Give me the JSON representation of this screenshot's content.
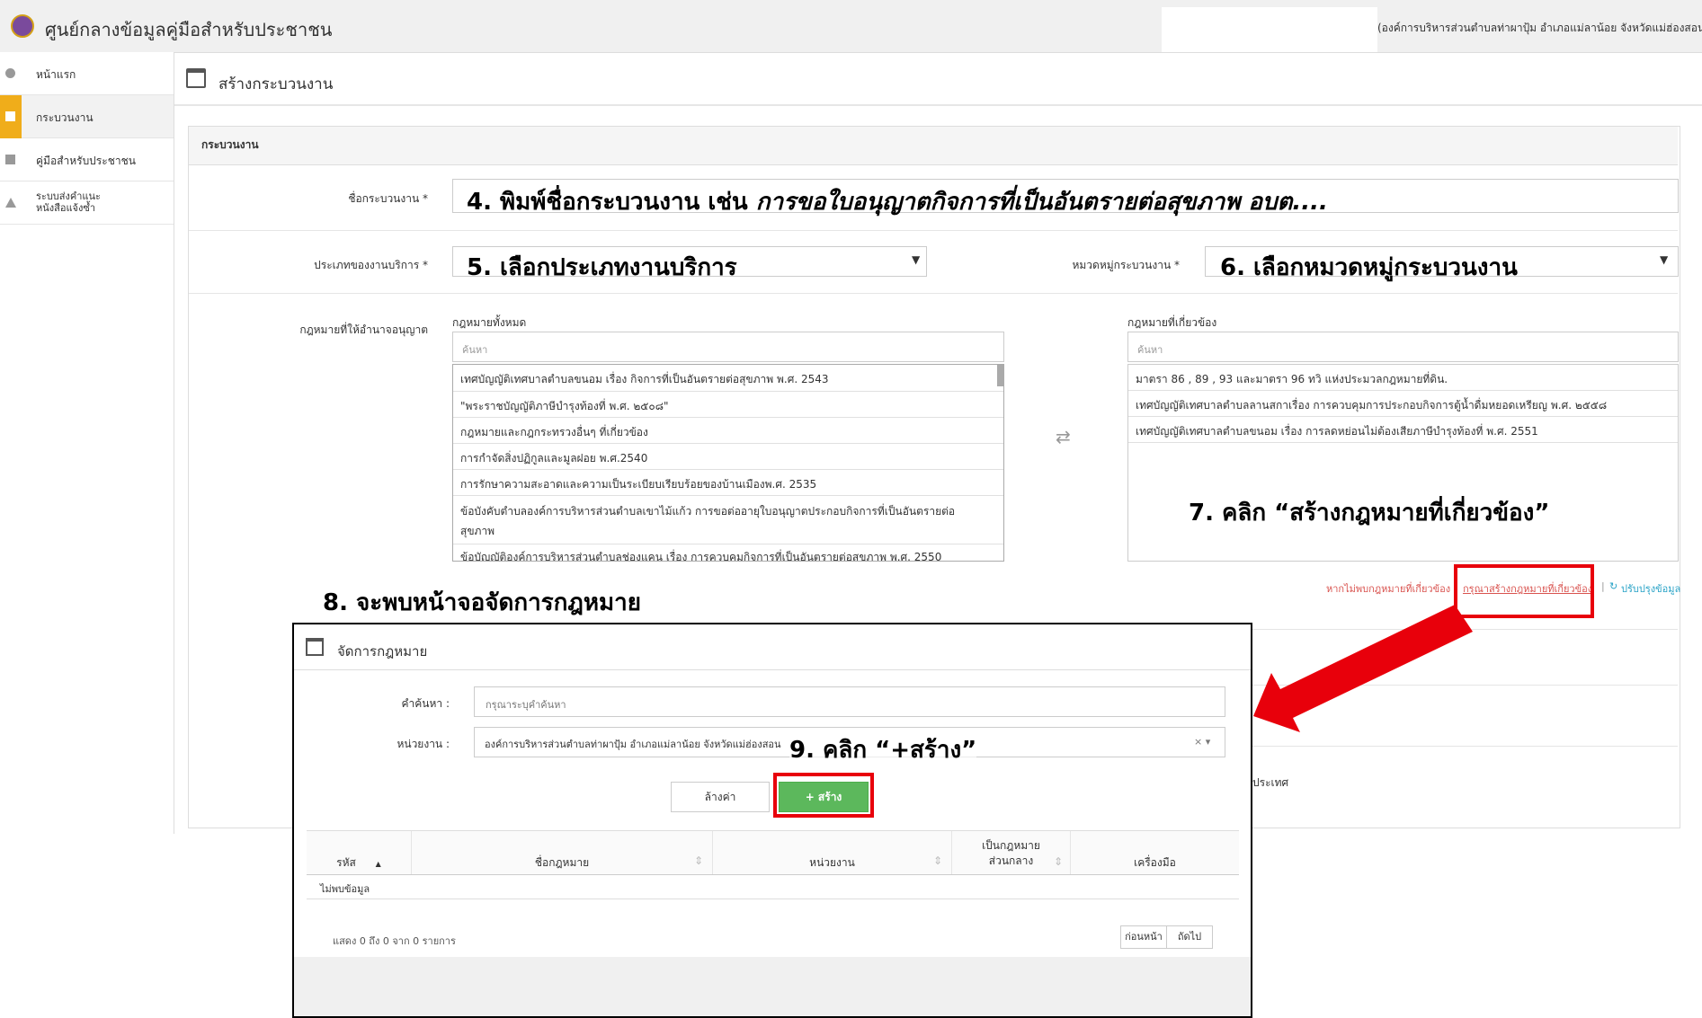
{
  "header": {
    "app_title": "ศูนย์กลางข้อมูลคู่มือสำหรับประชาชน",
    "org_name": "(องค์การบริหารส่วนตำบลท่าผาปุ้ม อำเภอแม่ลาน้อย จังหวัดแม่ฮ่องสอน) ▾"
  },
  "sidebar": {
    "items": [
      {
        "label": "หน้าแรก"
      },
      {
        "label": "กระบวนงาน"
      },
      {
        "label": "คู่มือสำหรับประชาชน"
      },
      {
        "label": "ระบบส่งคำแนะ\nหนังสือแจ้งซ้ำ"
      }
    ]
  },
  "page": {
    "title": "สร้างกระบวนงาน"
  },
  "panel": {
    "title": "กระบวนงาน"
  },
  "form": {
    "name_label": "ชื่อกระบวนงาน *",
    "service_type_label": "ประเภทของงานบริการ *",
    "category_label": "หมวดหมู่กระบวนงาน *",
    "law_label": "กฎหมายที่ให้อำนาจอนุญาต",
    "all_laws_title": "กฎหมายทั้งหมด",
    "related_laws_title": "กฎหมายที่เกี่ยวข้อง",
    "search_placeholder": "ค้นหา",
    "transfer_icon": "⇄",
    "not_found_text": "หากไม่พบกฎหมายที่เกี่ยวข้อง",
    "create_law_link": "กรุณาสร้างกฎหมายที่เกี่ยวข้อง",
    "link_sep": "|",
    "refresh_link": "ปรับปรุงข้อมูล",
    "country_text": "ประเทศ"
  },
  "all_laws": [
    "เทศบัญญัติเทศบาลตำบลขนอม เรื่อง กิจการที่เป็นอันตรายต่อสุขภาพ พ.ศ. 2543",
    "\"พระราชบัญญัติภาษีบำรุงท้องที่ พ.ศ. ๒๕๐๘\"",
    "กฎหมายและกฎกระทรวงอื่นๆ ที่เกี่ยวข้อง",
    "การกำจัดสิ่งปฏิกูลและมูลฝอย พ.ศ.2540",
    "การรักษาความสะอาดและความเป็นระเบียบเรียบร้อยของบ้านเมืองพ.ศ. 2535",
    "ข้อบังคับตำบลองค์การบริหารส่วนตำบลเขาไม้แก้ว การขอต่ออายุใบอนุญาตประกอบกิจการที่เป็นอันตรายต่อ\nสุขภาพ",
    "ข้อบัญญัติองค์การบริหารส่วนตำบลช่องแคน เรื่อง การควบคุมกิจการที่เป็นอันตรายต่อสุขภาพ พ.ศ. 2550"
  ],
  "related_laws": [
    "มาตรา 86 , 89 , 93 และมาตรา 96 ทวิ แห่งประมวลกฎหมายที่ดิน.",
    "เทศบัญญัติเทศบาลตำบลลานสกาเรื่อง การควบคุมการประกอบกิจการตู้น้ำดื่มหยอดเหรียญ พ.ศ. ๒๕๕๘",
    "เทศบัญญัติเทศบาลตำบลขนอม เรื่อง การลดหย่อนไม่ต้องเสียภาษีบำรุงท้องที่ พ.ศ. 2551"
  ],
  "annotations": {
    "step4_prefix": "4. พิมพ์ชื่อกระบวนงาน เช่น ",
    "step4_example": "การขอใบอนุญาตกิจการที่เป็นอันตรายต่อสุขภาพ อบต....",
    "step5": "5. เลือกประเภทงานบริการ",
    "step6": "6. เลือกหมวดหมู่กระบวนงาน",
    "step7": "7. คลิก “สร้างกฎหมายที่เกี่ยวข้อง”",
    "step8": "8. จะพบหน้าจอจัดการกฎหมาย",
    "step9": "9. คลิก “+สร้าง”"
  },
  "modal": {
    "title": "จัดการกฎหมาย",
    "keyword_label": "คำค้นหา :",
    "keyword_placeholder": "กรุณาระบุคำค้นหา",
    "agency_label": "หน่วยงาน :",
    "agency_value": "องค์การบริหารส่วนตำบลท่าผาปุ้ม อำเภอแม่ลาน้อย จังหวัดแม่ฮ่องสอน",
    "clear_glyph": "× ▾",
    "clear_button": "ล้างค่า",
    "create_button": "+ สร้าง",
    "columns": [
      "รหัส",
      "ชื่อกฎหมาย",
      "หน่วยงาน",
      "เป็นกฎหมาย\nส่วนกลาง",
      "เครื่องมือ"
    ],
    "sort_up": "▲",
    "sort_both": "⇕",
    "empty_text": "ไม่พบข้อมูล",
    "info_text": "แสดง 0 ถึง 0 จาก 0 รายการ",
    "prev_button": "ก่อนหน้า",
    "next_button": "ถัดไป"
  },
  "colors": {
    "accent": "#f0ad1a",
    "highlight": "#e8000b",
    "create_button": "#5cb85c",
    "link": "#d9534f"
  }
}
